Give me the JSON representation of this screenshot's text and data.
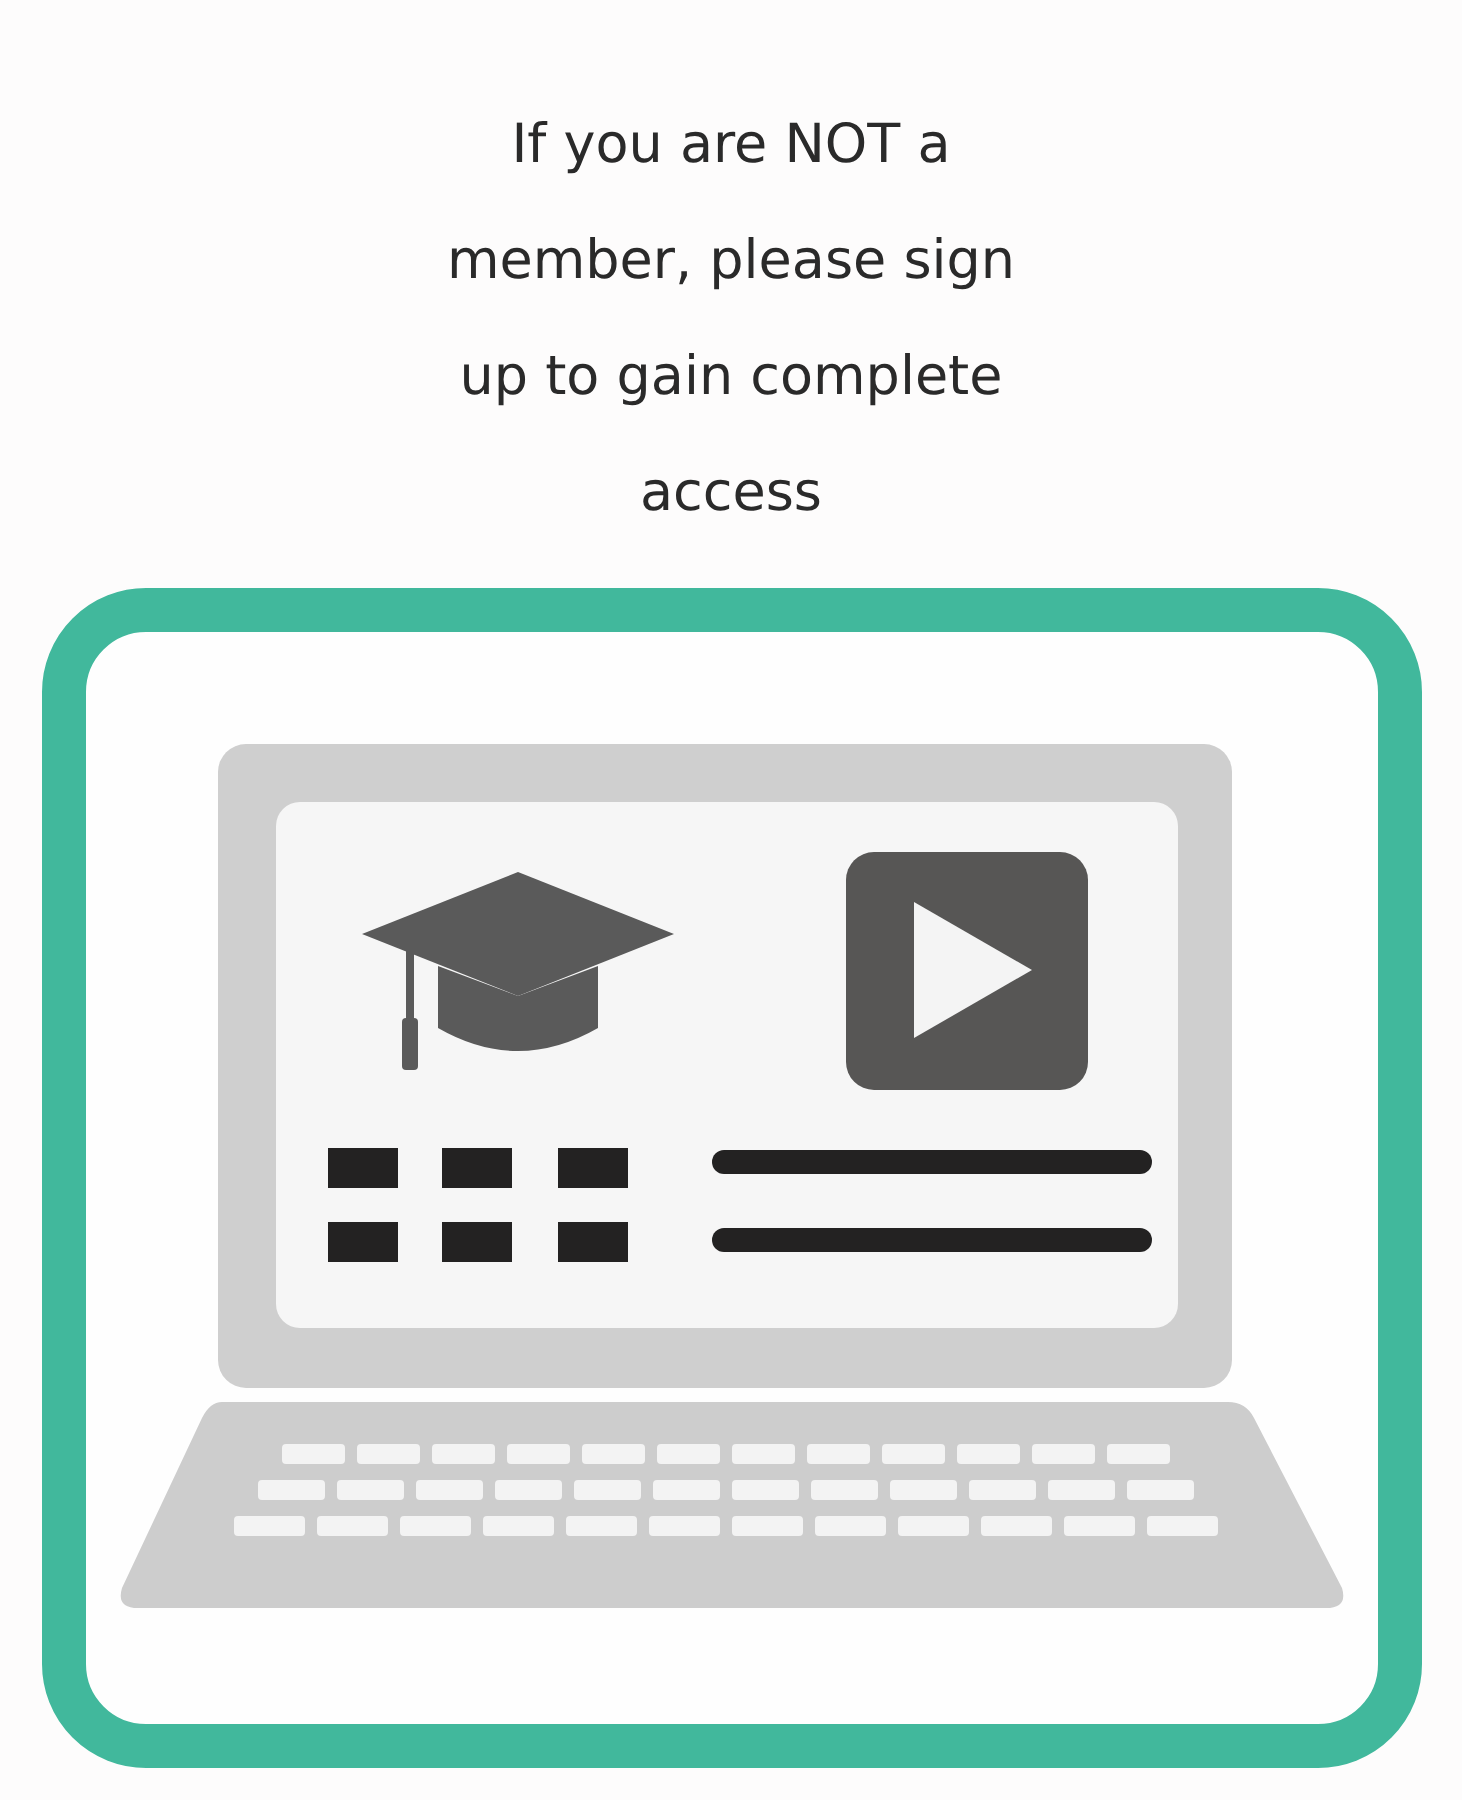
{
  "message": "If you are NOT a member, please sign up to gain complete access"
}
